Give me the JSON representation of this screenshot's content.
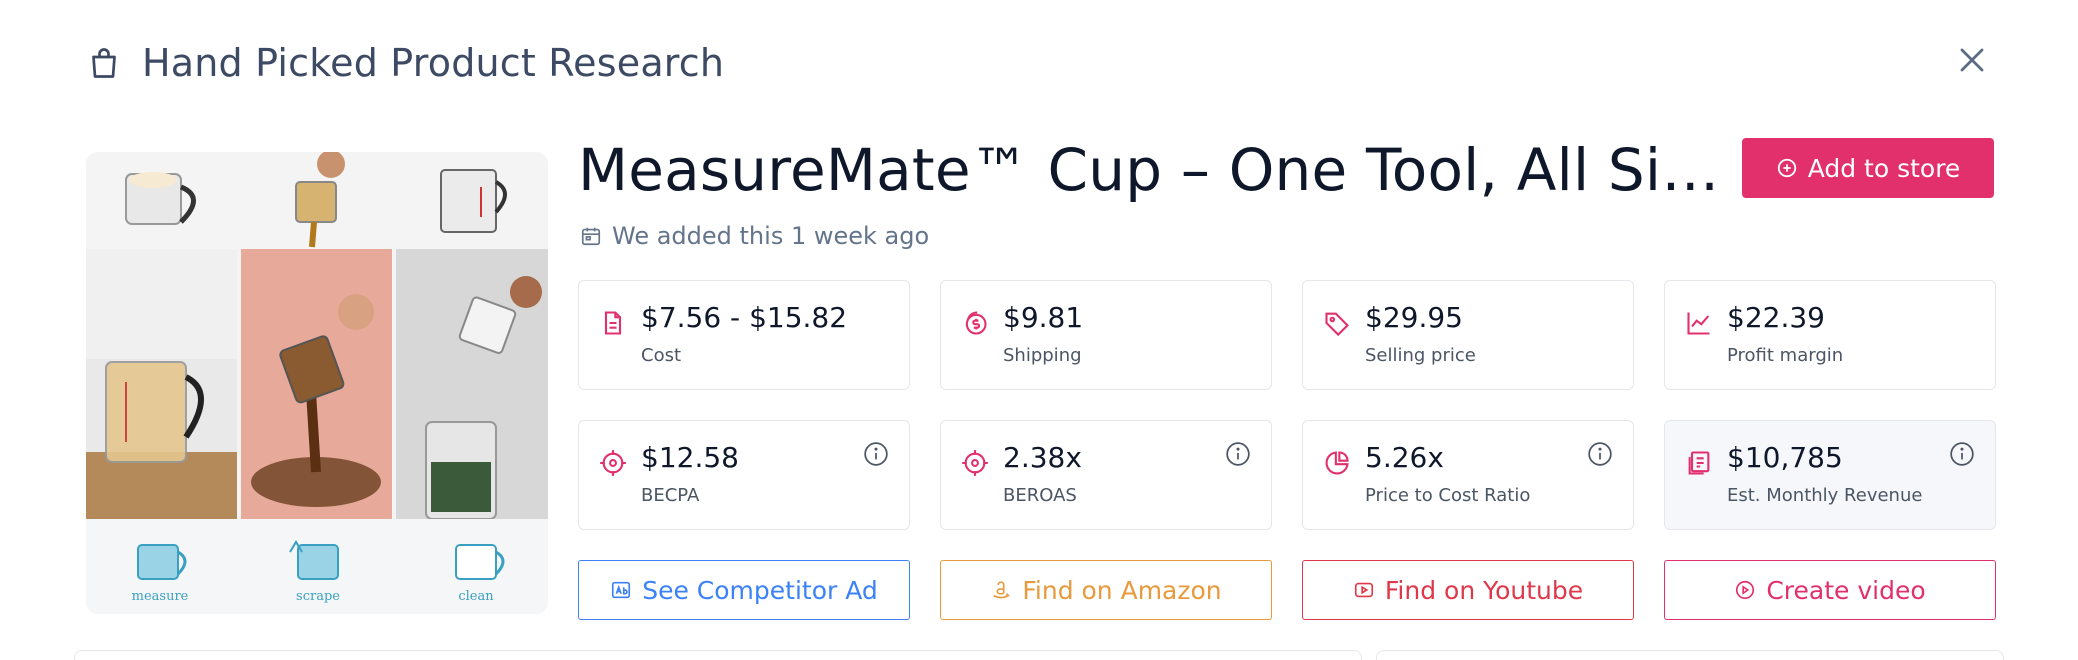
{
  "header": {
    "title": "Hand Picked Product Research"
  },
  "product": {
    "title": "MeasureMate™ Cup – One Tool, All Si…",
    "added_text": "We added this 1 week ago",
    "image_labels": [
      "measure",
      "scrape",
      "clean"
    ]
  },
  "actions": {
    "add_to_store": "Add to store",
    "see_competitor_ad": "See Competitor Ad",
    "find_on_amazon": "Find on Amazon",
    "find_on_youtube": "Find on Youtube",
    "create_video": "Create video"
  },
  "metrics": [
    {
      "value": "$7.56 - $15.82",
      "label": "Cost",
      "icon": "document-icon"
    },
    {
      "value": "$9.81",
      "label": "Shipping",
      "icon": "coins-icon"
    },
    {
      "value": "$29.95",
      "label": "Selling price",
      "icon": "tag-icon"
    },
    {
      "value": "$22.39",
      "label": "Profit margin",
      "icon": "trend-chart-icon"
    },
    {
      "value": "$12.58",
      "label": "BECPA",
      "icon": "crosshair-icon"
    },
    {
      "value": "2.38x",
      "label": "BEROAS",
      "icon": "crosshair-icon"
    },
    {
      "value": "5.26x",
      "label": "Price to Cost Ratio",
      "icon": "pie-chart-icon"
    },
    {
      "value": "$10,785",
      "label": "Est. Monthly Revenue",
      "icon": "receipt-icon"
    }
  ],
  "colors": {
    "accent": "#e1306c",
    "title_text": "#3d4a63",
    "competitor": "#3b82f6",
    "amazon": "#e89a3c",
    "youtube": "#e0384a",
    "create": "#e1306c"
  }
}
